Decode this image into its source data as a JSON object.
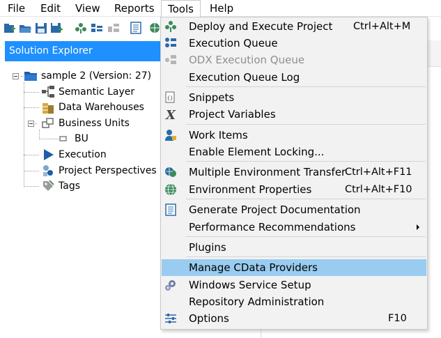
{
  "menubar": {
    "items": [
      {
        "label": "File"
      },
      {
        "label": "Edit"
      },
      {
        "label": "View"
      },
      {
        "label": "Reports"
      },
      {
        "label": "Tools"
      },
      {
        "label": "Help"
      }
    ]
  },
  "solution_explorer": {
    "title": "Solution Explorer",
    "tree": {
      "root": "sample 2 (Version: 27)",
      "semantic_layer": "Semantic Layer",
      "data_warehouses": "Data Warehouses",
      "business_units": "Business Units",
      "bu": "BU",
      "execution": "Execution",
      "project_perspectives": "Project Perspectives",
      "tags": "Tags"
    }
  },
  "tools_menu": {
    "items": [
      {
        "label": "Deploy and Execute Project",
        "shortcut": "Ctrl+Alt+M",
        "icon": "deploy-icon"
      },
      {
        "label": "Execution Queue",
        "icon": "execution-queue-icon"
      },
      {
        "label": "ODX Execution Queue",
        "icon": "odx-queue-icon",
        "disabled": true
      },
      {
        "label": "Execution Queue Log"
      },
      {
        "label": "Snippets",
        "icon": "snippets-icon"
      },
      {
        "label": "Project Variables",
        "icon": "variables-icon"
      },
      {
        "label": "Work Items",
        "icon": "work-items-icon"
      },
      {
        "label": "Enable Element Locking..."
      },
      {
        "label": "Multiple Environment Transfer",
        "shortcut": "Ctrl+Alt+F11",
        "icon": "transfer-icon"
      },
      {
        "label": "Environment Properties",
        "shortcut": "Ctrl+Alt+F10",
        "icon": "globe-icon"
      },
      {
        "label": "Generate Project Documentation",
        "icon": "document-icon"
      },
      {
        "label": "Performance Recommendations",
        "submenu": true
      },
      {
        "label": "Plugins"
      },
      {
        "label": "Manage CData Providers",
        "highlighted": true
      },
      {
        "label": "Windows Service Setup",
        "icon": "gears-icon"
      },
      {
        "label": "Repository Administration"
      },
      {
        "label": "Options",
        "shortcut": "F10",
        "icon": "options-icon"
      }
    ]
  },
  "colors": {
    "accent": "#1e90ff",
    "menu_highlight": "#99ccf0",
    "menu_bg": "#f2f2f2",
    "disabled_text": "#8f8f8f"
  }
}
